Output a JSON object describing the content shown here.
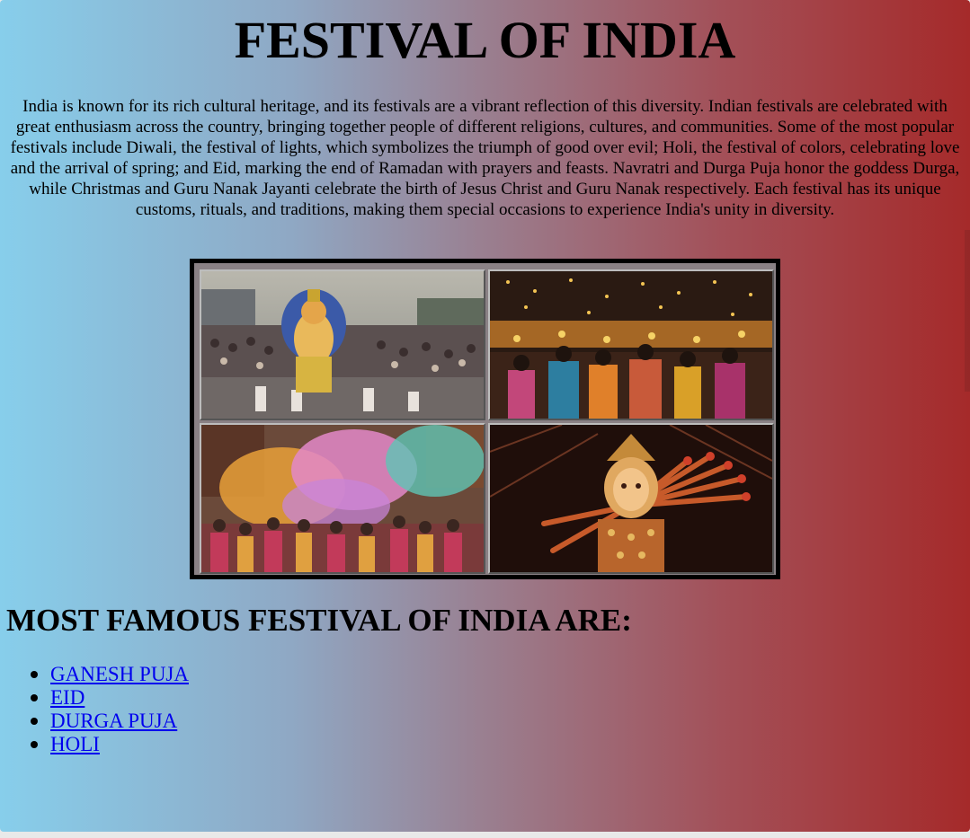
{
  "header": {
    "title": "FESTIVAL OF INDIA"
  },
  "intro": {
    "text": "India is known for its rich cultural heritage, and its festivals are a vibrant reflection of this diversity. Indian festivals are celebrated with great enthusiasm across the country, bringing together people of different religions, cultures, and communities. Some of the most popular festivals include Diwali, the festival of lights, which symbolizes the triumph of good over evil; Holi, the festival of colors, celebrating love and the arrival of spring; and Eid, marking the end of Ramadan with prayers and feasts. Navratri and Durga Puja honor the goddess Durga, while Christmas and Guru Nanak Jayanti celebrate the birth of Jesus Christ and Guru Nanak respectively. Each festival has its unique customs, rituals, and traditions, making them special occasions to experience India's unity in diversity."
  },
  "gallery": {
    "images": [
      {
        "subject": "ganesh-idol-crowd"
      },
      {
        "subject": "diwali-lights-crowd"
      },
      {
        "subject": "holi-colors-crowd"
      },
      {
        "subject": "durga-idol"
      }
    ]
  },
  "section": {
    "heading": "MOST FAMOUS FESTIVAL OF INDIA ARE:"
  },
  "festivals": [
    {
      "label": "GANESH PUJA"
    },
    {
      "label": "EID"
    },
    {
      "label": "DURGA PUJA"
    },
    {
      "label": "HOLI"
    }
  ],
  "colors": {
    "gradient_start": "#87ceeb",
    "gradient_end": "#a52a2a",
    "link": "#0000ee"
  }
}
